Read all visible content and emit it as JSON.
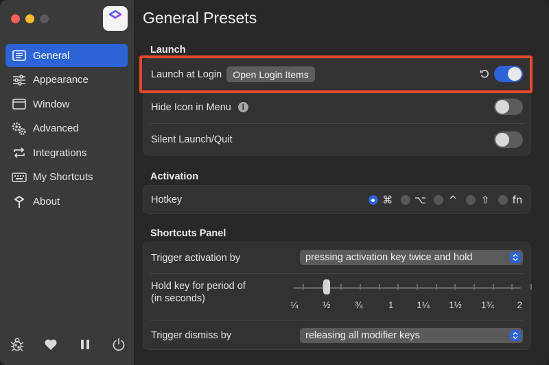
{
  "sidebar": {
    "items": [
      {
        "label": "General",
        "icon": "general-icon",
        "active": true
      },
      {
        "label": "Appearance",
        "icon": "sliders-icon"
      },
      {
        "label": "Window",
        "icon": "window-icon"
      },
      {
        "label": "Advanced",
        "icon": "gears-icon"
      },
      {
        "label": "Integrations",
        "icon": "sync-arrows-icon"
      },
      {
        "label": "My Shortcuts",
        "icon": "keyboard-icon"
      },
      {
        "label": "About",
        "icon": "about-logo-icon"
      }
    ],
    "bottom_icons": [
      "bug-icon",
      "heart-icon",
      "pause-icon",
      "power-icon"
    ]
  },
  "main": {
    "title": "General Presets",
    "launch": {
      "title": "Launch",
      "launch_at_login": {
        "label": "Launch at Login",
        "button": "Open Login Items",
        "enabled": true
      },
      "hide_icon": {
        "label": "Hide Icon in Menu",
        "enabled": false
      },
      "silent": {
        "label": "Silent Launch/Quit",
        "enabled": false
      }
    },
    "activation": {
      "title": "Activation",
      "hotkey_label": "Hotkey",
      "keys": [
        "⌘",
        "⌥",
        "^",
        "⇧",
        "fn"
      ],
      "selected_key": "⌘"
    },
    "shortcuts_panel": {
      "title": "Shortcuts Panel",
      "trigger_activation": {
        "label": "Trigger activation by",
        "value": "pressing activation key twice and hold"
      },
      "hold_key": {
        "label_line1": "Hold key for period of",
        "label_line2": "(in seconds)",
        "value": 0.5
      },
      "tick_labels": [
        "¼",
        "½",
        "¾",
        "1",
        "1¼",
        "1½",
        "1¾",
        "2"
      ],
      "trigger_dismiss": {
        "label": "Trigger dismiss by",
        "value": "releasing all modifier keys"
      }
    }
  },
  "colors": {
    "accent": "#2c63d7",
    "highlight_border": "#e8482c"
  }
}
